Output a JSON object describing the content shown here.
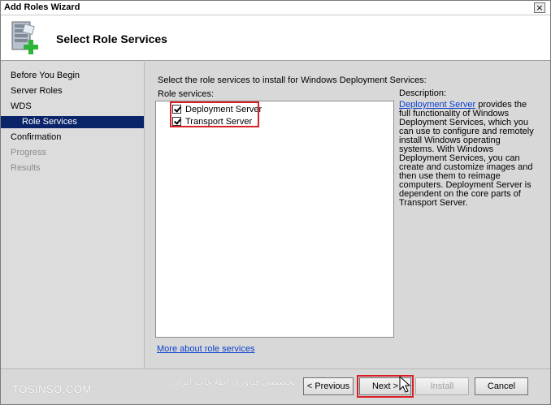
{
  "window": {
    "title": "Add Roles Wizard",
    "close_glyph": "×"
  },
  "header": {
    "title": "Select Role Services",
    "icon": "server-add-icon"
  },
  "sidebar": {
    "items": [
      {
        "label": "Before You Begin",
        "state": "normal"
      },
      {
        "label": "Server Roles",
        "state": "normal"
      },
      {
        "label": "WDS",
        "state": "normal"
      },
      {
        "label": "Role Services",
        "state": "active"
      },
      {
        "label": "Confirmation",
        "state": "normal"
      },
      {
        "label": "Progress",
        "state": "disabled"
      },
      {
        "label": "Results",
        "state": "disabled"
      }
    ]
  },
  "content": {
    "intro": "Select the role services to install for Windows Deployment Services:",
    "role_services_label": "Role services:",
    "role_services": [
      {
        "label": "Deployment Server",
        "checked": true
      },
      {
        "label": "Transport Server",
        "checked": true
      }
    ],
    "description_label": "Description:",
    "description_link": "Deployment Server",
    "description_text": " provides the full functionality of Windows Deployment Services, which you can use to configure and remotely install Windows operating systems. With Windows Deployment Services, you can create and customize images and then use them to reimage computers. Deployment Server is dependent on the core parts of Transport Server.",
    "more_link": "More about role services"
  },
  "footer": {
    "watermark_left": "TOSINSO.COM",
    "watermark_right": "انجمن تخصصی فناوری اطلاعات ایران",
    "previous_label": "< Previous",
    "next_label": "Next >",
    "install_label": "Install",
    "cancel_label": "Cancel"
  },
  "colors": {
    "highlight": "#d91f26",
    "link": "#0b3fd0",
    "active_nav": "#0a246a"
  }
}
